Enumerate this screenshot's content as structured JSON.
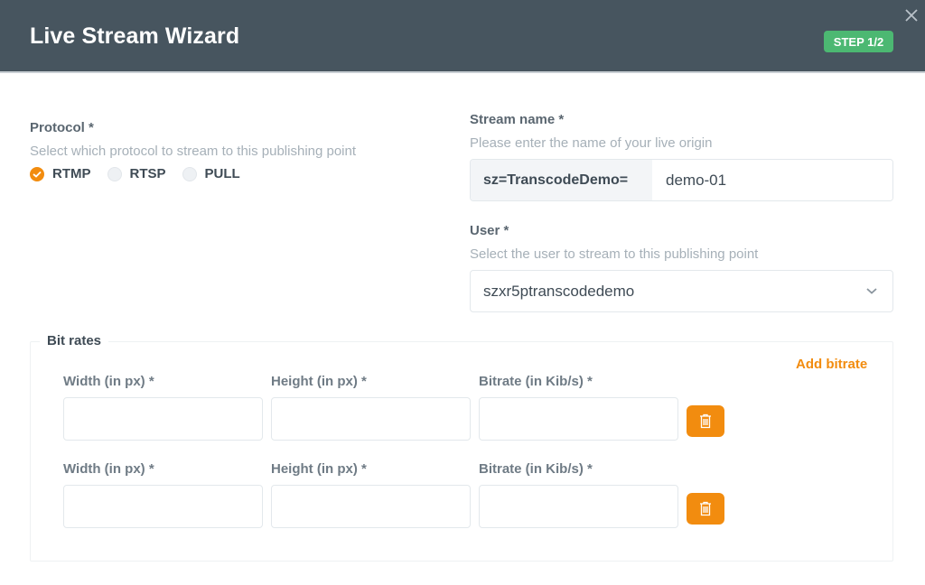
{
  "header": {
    "title": "Live Stream Wizard",
    "step_badge": "STEP 1/2",
    "close_icon": "close-icon"
  },
  "protocol": {
    "label": "Protocol *",
    "hint": "Select which protocol to stream to this publishing point",
    "options": [
      {
        "label": "RTMP",
        "checked": true
      },
      {
        "label": "RTSP",
        "checked": false
      },
      {
        "label": "PULL",
        "checked": false
      }
    ]
  },
  "stream_name": {
    "label": "Stream name *",
    "hint": "Please enter the name of your live origin",
    "prefix": "sz=TranscodeDemo=",
    "value": "demo-01"
  },
  "user": {
    "label": "User *",
    "hint": "Select the user to stream to this publishing point",
    "selected": "szxr5ptranscodedemo"
  },
  "bitrates": {
    "legend": "Bit rates",
    "add_label": "Add bitrate",
    "rows": [
      {
        "width_label": "Width (in px) *",
        "height_label": "Height (in px) *",
        "bitrate_label": "Bitrate (in Kib/s) *",
        "width": "",
        "height": "",
        "bitrate": ""
      },
      {
        "width_label": "Width (in px) *",
        "height_label": "Height (in px) *",
        "bitrate_label": "Bitrate (in Kib/s) *",
        "width": "",
        "height": "",
        "bitrate": ""
      }
    ]
  },
  "colors": {
    "header_bg": "#47555f",
    "accent": "#f28c0f",
    "badge": "#4cb872"
  }
}
